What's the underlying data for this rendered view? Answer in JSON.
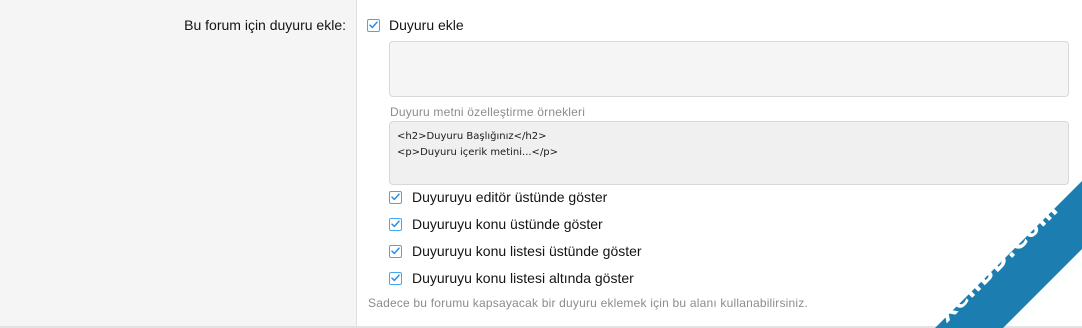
{
  "field": {
    "label": "Bu forum için duyuru ekle:"
  },
  "add_notice": {
    "label": "Duyuru ekle",
    "checked": true
  },
  "notice_text": {
    "value": ""
  },
  "examples": {
    "label": "Duyuru metni özelleştirme örnekleri",
    "lines": [
      "<h2>Duyuru Başlığınız</h2>",
      "<p>Duyuru içerik metini...</p>"
    ]
  },
  "options": [
    {
      "label": "Duyuruyu editör üstünde göster",
      "checked": true
    },
    {
      "label": "Duyuruyu konu üstünde göster",
      "checked": true
    },
    {
      "label": "Duyuruyu konu listesi üstünde göster",
      "checked": true
    },
    {
      "label": "Duyuruyu konu listesi altında göster",
      "checked": true
    }
  ],
  "explain": "Sadece bu forumu kapsayacak bir duyuru eklemek için bu alanı kullanabilirsiniz.",
  "watermark": {
    "text": "XenBD.Com"
  },
  "colors": {
    "label_column_bg": "#f5f5f5",
    "checkbox_accent": "#47a7eb",
    "watermark_band": "#1c7eb0",
    "hint_text": "#8c8c8c"
  },
  "icons": {
    "checkbox": "checkmark-icon"
  }
}
